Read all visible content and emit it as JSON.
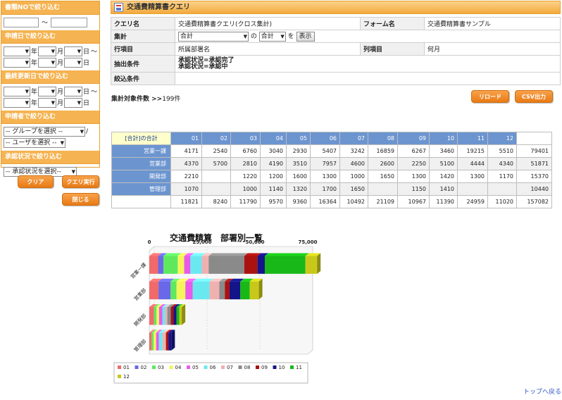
{
  "sidebar": {
    "doc_no_header": "書類NOで絞り込む",
    "doc_no_sep": "～",
    "apply_date_header": "申請日で絞り込む",
    "updated_date_header": "最終更新日で絞り込む",
    "unit_year": "年",
    "unit_month": "月",
    "unit_day": "日",
    "range_sep": "～",
    "applicant_header": "申請者で絞り込む",
    "group_select": "-- グループを選択 --",
    "group_sep": "/",
    "user_select": "-- ユーザを選択 --",
    "approval_header": "承認状況で絞り込む",
    "approval_select": "-- 承認状況を選択--",
    "clear_button": "クリア",
    "run_button": "クエリ実行",
    "close_button": "閉じる"
  },
  "query": {
    "title": "交通費精算書クエリ",
    "labels": {
      "query_name": "クエリ名",
      "form_name": "フォーム名",
      "aggregate": "集計",
      "row_item": "行項目",
      "column_item": "列項目",
      "extract": "抽出条件",
      "filter": "絞込条件"
    },
    "query_name": "交通費精算書クエリ(クロス集計)",
    "form_name": "交通費精算書サンプル",
    "aggregate_field": "合計",
    "aggregate_of": "の",
    "aggregate_func": "合計",
    "aggregate_suffix": "を",
    "show_button": "表示",
    "row_item": "所属部署名",
    "column_item": "何月",
    "extract_line1": "承認状況=承認完了",
    "extract_line2": "承認状況=承認中",
    "filter": ""
  },
  "count": {
    "label": "集計対象件数 >>",
    "value": "199件"
  },
  "buttons": {
    "reload": "リロード",
    "csv": "CSV出力"
  },
  "cross": {
    "corner": "[合計]の合計",
    "months": [
      "01",
      "02",
      "03",
      "04",
      "05",
      "06",
      "07",
      "08",
      "09",
      "10",
      "11",
      "12"
    ],
    "rows": [
      {
        "name": "営業一課",
        "values": [
          "4171",
          "2540",
          "6760",
          "3040",
          "2930",
          "5407",
          "3242",
          "16859",
          "6267",
          "3460",
          "19215",
          "5510"
        ],
        "total": "79401"
      },
      {
        "name": "営業部",
        "values": [
          "4370",
          "5700",
          "2810",
          "4190",
          "3510",
          "7957",
          "4600",
          "2600",
          "2250",
          "5100",
          "4444",
          "4340"
        ],
        "total": "51871"
      },
      {
        "name": "開発部",
        "values": [
          "2210",
          "",
          "1220",
          "1200",
          "1600",
          "1300",
          "1000",
          "1650",
          "1300",
          "1420",
          "1300",
          "1170"
        ],
        "total": "15370"
      },
      {
        "name": "管理部",
        "values": [
          "1070",
          "",
          "1000",
          "1140",
          "1320",
          "1700",
          "1650",
          "",
          "1150",
          "1410",
          "",
          ""
        ],
        "total": "10440"
      }
    ],
    "totals": [
      "11821",
      "8240",
      "11790",
      "9570",
      "9360",
      "16364",
      "10492",
      "21109",
      "10967",
      "11390",
      "24959",
      "11020"
    ],
    "grand_total": "157082"
  },
  "chart_data": {
    "type": "bar",
    "title": "交通費精算　部署別一覧",
    "orientation": "horizontal-stacked",
    "categories": [
      "営業一課",
      "営業部",
      "開発部",
      "管理部"
    ],
    "xlim": [
      0,
      75000
    ],
    "x_ticks": [
      "0",
      "25,000",
      "50,000",
      "75,000"
    ],
    "series": [
      {
        "name": "01",
        "color": "#f06a6a",
        "values": [
          4171,
          4370,
          2210,
          1070
        ]
      },
      {
        "name": "02",
        "color": "#6868e8",
        "values": [
          2540,
          5700,
          0,
          0
        ]
      },
      {
        "name": "03",
        "color": "#5ee85e",
        "values": [
          6760,
          2810,
          1220,
          1000
        ]
      },
      {
        "name": "04",
        "color": "#f5f55a",
        "values": [
          3040,
          4190,
          1200,
          1140
        ]
      },
      {
        "name": "05",
        "color": "#e85ae8",
        "values": [
          2930,
          3510,
          1600,
          1320
        ]
      },
      {
        "name": "06",
        "color": "#6ae8f0",
        "values": [
          5407,
          7957,
          1300,
          1700
        ]
      },
      {
        "name": "07",
        "color": "#f0b0b0",
        "values": [
          3242,
          4600,
          1000,
          1650
        ]
      },
      {
        "name": "08",
        "color": "#8a8a8a",
        "values": [
          16859,
          2600,
          1650,
          0
        ]
      },
      {
        "name": "09",
        "color": "#aa1111",
        "values": [
          6267,
          2250,
          1300,
          1150
        ]
      },
      {
        "name": "10",
        "color": "#15158a",
        "values": [
          3460,
          5100,
          1420,
          1410
        ]
      },
      {
        "name": "11",
        "color": "#18b818",
        "values": [
          19215,
          4444,
          1300,
          0
        ]
      },
      {
        "name": "12",
        "color": "#c8c81a",
        "values": [
          5510,
          4340,
          1170,
          0
        ]
      }
    ]
  },
  "footer": {
    "to_top": "トップへ戻る"
  }
}
